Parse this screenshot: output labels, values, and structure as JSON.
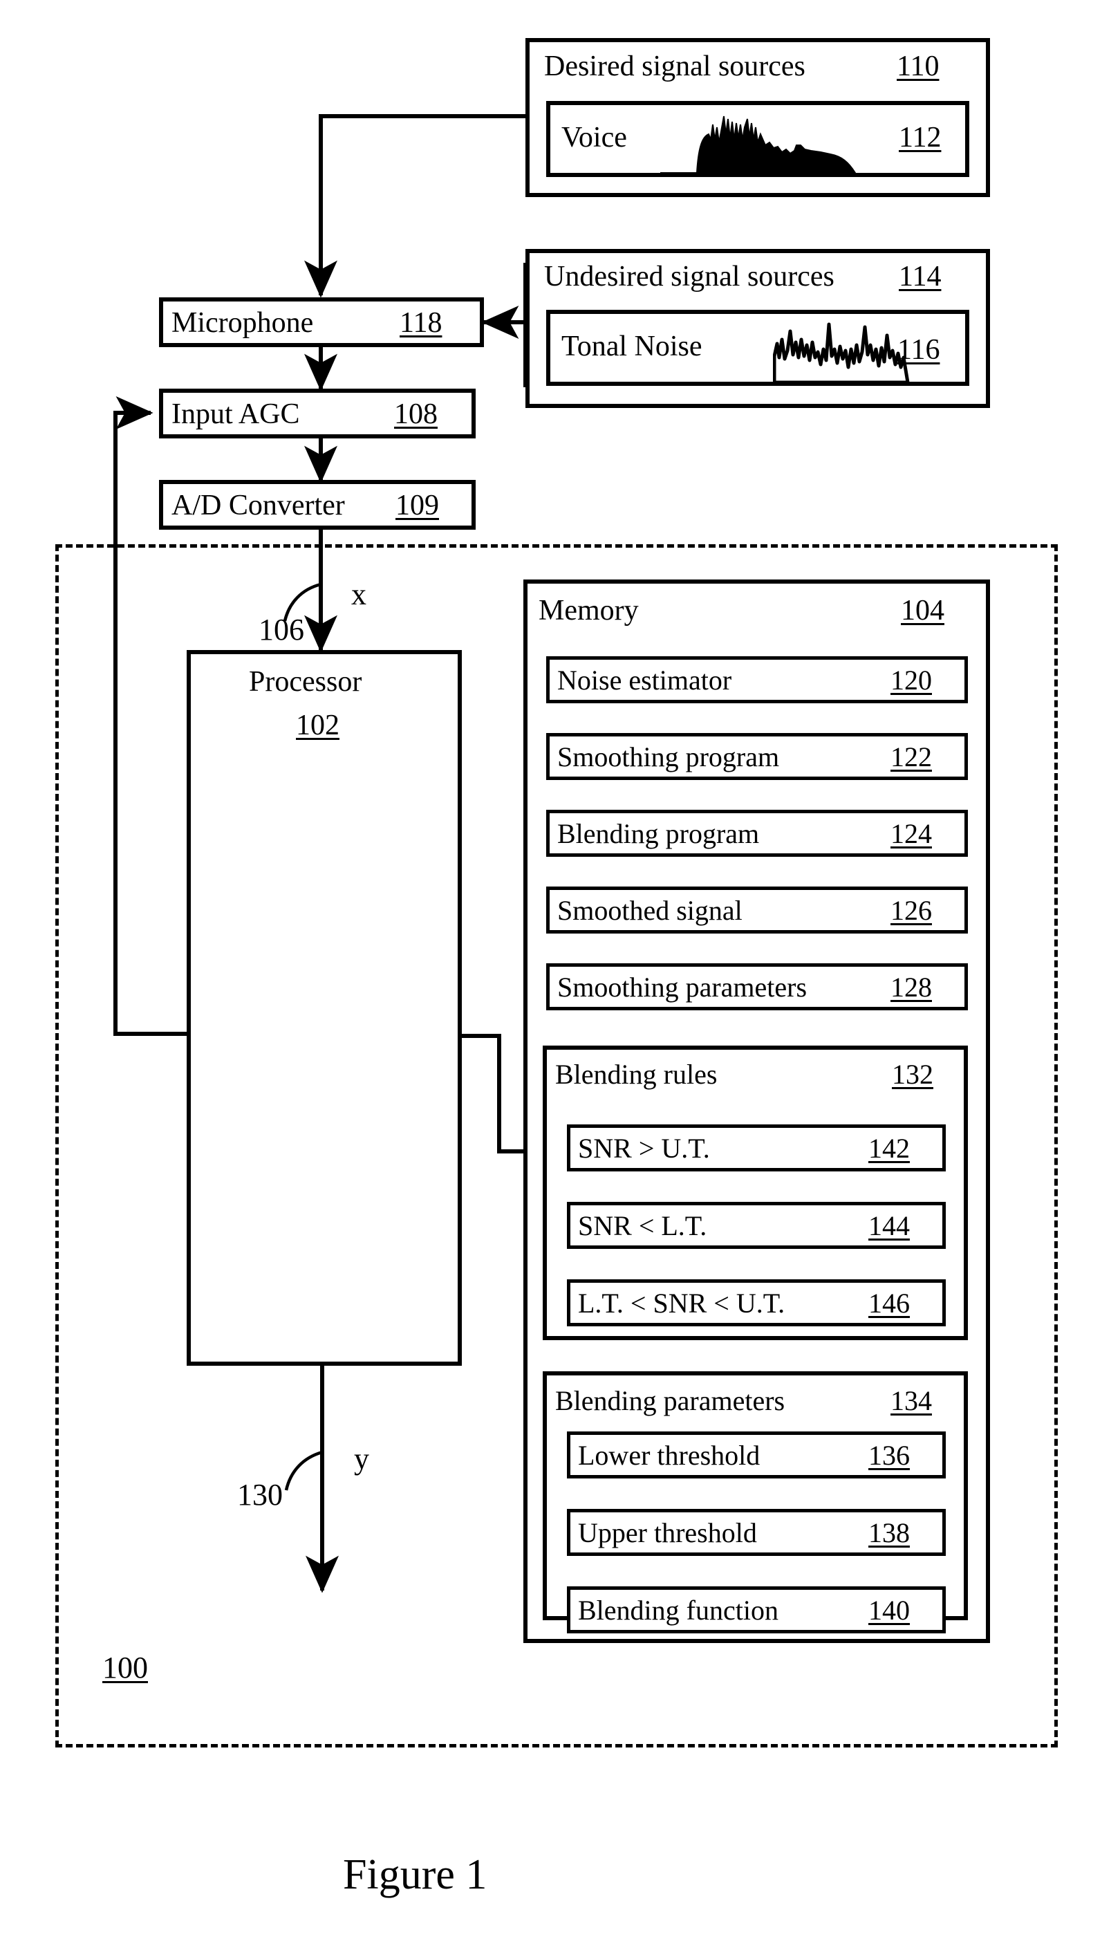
{
  "figure": {
    "caption": "Figure 1",
    "system_ref": "100"
  },
  "sources": {
    "desired": {
      "title": "Desired signal sources",
      "ref": "110",
      "items": [
        {
          "label": "Voice",
          "ref": "112",
          "waveform": "voice-envelope"
        }
      ]
    },
    "undesired": {
      "title": "Undesired signal sources",
      "ref": "114",
      "items": [
        {
          "label": "Tonal Noise",
          "ref": "116",
          "waveform": "tonal-noise-spikes"
        }
      ]
    }
  },
  "signal_chain": [
    {
      "label": "Microphone",
      "ref": "118"
    },
    {
      "label": "Input AGC",
      "ref": "108"
    },
    {
      "label": "A/D Converter",
      "ref": "109"
    }
  ],
  "processor": {
    "label": "Processor",
    "ref": "102"
  },
  "signals": {
    "input": {
      "name": "x",
      "ref": "106"
    },
    "output": {
      "name": "y",
      "ref": "130"
    }
  },
  "memory": {
    "title": "Memory",
    "ref": "104",
    "items": [
      {
        "label": "Noise estimator",
        "ref": "120"
      },
      {
        "label": "Smoothing program",
        "ref": "122"
      },
      {
        "label": "Blending program",
        "ref": "124"
      },
      {
        "label": "Smoothed signal",
        "ref": "126"
      },
      {
        "label": "Smoothing parameters",
        "ref": "128"
      }
    ],
    "blending_rules": {
      "title": "Blending rules",
      "ref": "132",
      "items": [
        {
          "label": "SNR > U.T.",
          "ref": "142"
        },
        {
          "label": "SNR < L.T.",
          "ref": "144"
        },
        {
          "label": "L.T. < SNR < U.T.",
          "ref": "146"
        }
      ]
    },
    "blending_parameters": {
      "title": "Blending parameters",
      "ref": "134",
      "items": [
        {
          "label": "Lower threshold",
          "ref": "136"
        },
        {
          "label": "Upper threshold",
          "ref": "138"
        },
        {
          "label": "Blending function",
          "ref": "140"
        }
      ]
    }
  }
}
